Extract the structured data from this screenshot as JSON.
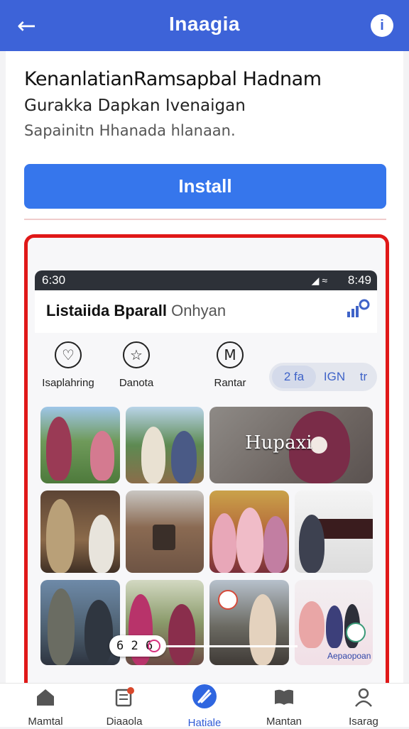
{
  "appbar": {
    "title": "Inaagia",
    "back_icon": "back-arrow-icon",
    "info_icon": "info-icon"
  },
  "app": {
    "name": "KenanlatianRamsapbal Hadnam",
    "developer": "Gurakka Dapkan Ivenaigan",
    "tagline": "Sapainitn Hhanada hlanaan.",
    "install_label": "Install"
  },
  "preview": {
    "status_time": "6:30",
    "status_time_right": "8:49",
    "title": "Listaiida Bparall",
    "title_sub": "Onhyan",
    "categories": [
      {
        "label": "Isaplahring",
        "icon": "heart-icon"
      },
      {
        "label": "Danota",
        "icon": "star-icon"
      },
      {
        "label": "Rantar",
        "icon": "m-logo-icon"
      }
    ],
    "pills": [
      "2 fa",
      "IGN",
      "tr"
    ],
    "featured_text": "Hupaxi",
    "last_tile_label": "Aepaopoan",
    "counter": "6 2 6"
  },
  "bottom_nav": [
    {
      "label": "Mamtal",
      "icon": "home-icon"
    },
    {
      "label": "Diaaola",
      "icon": "notes-icon"
    },
    {
      "label": "Hatiale",
      "icon": "rocket-icon"
    },
    {
      "label": "Mantan",
      "icon": "book-icon"
    },
    {
      "label": "Isarag",
      "icon": "profile-icon"
    }
  ],
  "colors": {
    "primary": "#3d63d8",
    "install": "#3676ec",
    "frame_border": "#e01818"
  }
}
